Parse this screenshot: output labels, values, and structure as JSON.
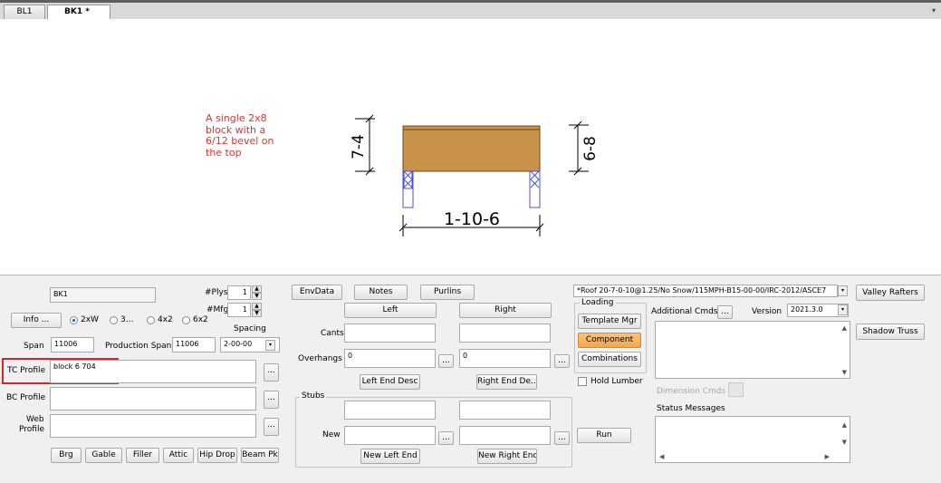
{
  "tabs": [
    {
      "label": "BL1",
      "active": false
    },
    {
      "label": "BK1 *",
      "active": true
    }
  ],
  "tab_close_glyph": "×",
  "tabbar_dropdown_glyph": "▾",
  "drawing": {
    "note": [
      "A single 2x8",
      "block with a",
      "6/12 bevel on",
      "the top"
    ],
    "left_height": "7-4",
    "right_height": "6-8",
    "span": "1-10-6",
    "colors": {
      "lumber": "#c8924a",
      "note": "#e8302b",
      "bearing": "#4a4fd9"
    }
  },
  "panel": {
    "truss_name": "BK1",
    "plys_label": "#Plys",
    "plys_value": "1",
    "mfg_label": "#Mfg",
    "mfg_value": "1",
    "info_button": "Info ...",
    "lumber_options": [
      "2xW",
      "3...",
      "4x2",
      "6x2"
    ],
    "lumber_selected": 0,
    "spacing_label": "Spacing",
    "spacing_value": "2-00-00",
    "span_label": "Span",
    "span_value": "11006",
    "production_span_label": "Production Span",
    "production_span_value": "11006",
    "tc_profile_label": "TC Profile",
    "tc_profile_value": "block 6 704",
    "bc_profile_label": "BC Profile",
    "bc_profile_value": "",
    "web_profile_label": [
      "Web",
      "Profile"
    ],
    "web_profile_value": "",
    "ellipsis": "...",
    "bottom_buttons": [
      "Brg",
      "Gable",
      "Filler",
      "Attic",
      "Hip Drop",
      "Beam Pk"
    ],
    "envdata_button": "EnvData",
    "notes_button": "Notes",
    "purlins_button": "Purlins",
    "left_button": "Left",
    "right_button": "Right",
    "cants_label": "Cants",
    "overhangs_label": "Overhangs",
    "overhang_left_value": "0",
    "overhang_right_value": "0",
    "left_end_desc_button": "Left End Desc",
    "right_end_desc_button": "Right End De...",
    "stubs_label": "Stubs",
    "new_label": "New",
    "new_left_end_button": "New Left End",
    "new_right_end_button": "New Right End",
    "loading_value": "*Roof 20-7-0-10@1.25/No Snow/115MPH-B15-00-00/IRC-2012/ASCE7",
    "loading_group_label": "Loading",
    "template_mgr_button": "Template Mgr",
    "component_button": "Component",
    "combinations_button": "Combinations",
    "hold_lumber_label": "Hold Lumber",
    "run_button": "Run",
    "additional_cmds_label": "Additional Cmds",
    "version_label": "Version",
    "version_value": "2021.3.0",
    "dimension_cmds_label": "Dimension Cmds",
    "status_messages_label": "Status Messages",
    "valley_rafters_button": "Valley Rafters",
    "shadow_truss_button": "Shadow Truss",
    "component_color": "#f4a64a"
  }
}
